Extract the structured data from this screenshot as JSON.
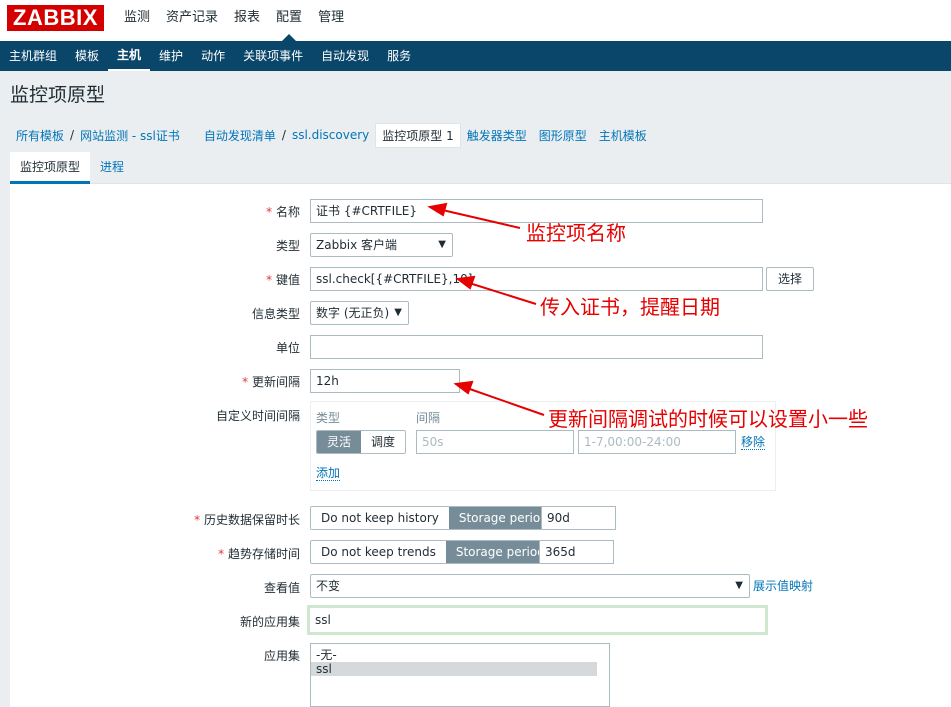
{
  "brand": {
    "logo": "ZABBIX"
  },
  "topnav": [
    "监测",
    "资产记录",
    "报表",
    "配置",
    "管理"
  ],
  "subnav": [
    "主机群组",
    "模板",
    "主机",
    "维护",
    "动作",
    "关联项事件",
    "自动发现",
    "服务"
  ],
  "page_title": "监控项原型",
  "breadcrumbs": [
    "所有模板",
    "网站监测 - ssl证书",
    "自动发现清单",
    "ssl.discovery",
    "监控项原型 1",
    "触发器类型",
    "图形原型",
    "主机模板"
  ],
  "tabs": [
    "监控项原型",
    "进程"
  ],
  "form": {
    "name_label": "名称",
    "name_value": "证书 {#CRTFILE}",
    "type_label": "类型",
    "type_value": "Zabbix 客户端",
    "key_label": "键值",
    "key_value": "ssl.check[{#CRTFILE},10]",
    "key_select": "选择",
    "info_type_label": "信息类型",
    "info_type_value": "数字 (无正负)",
    "units_label": "单位",
    "units_value": "",
    "interval_label": "更新间隔",
    "interval_value": "12h",
    "custom_label": "自定义时间间隔",
    "custom_col_type": "类型",
    "custom_col_interval": "间隔",
    "custom_flex": "灵活",
    "custom_sched": "调度",
    "custom_interval_ph": "50s",
    "custom_period_ph": "1-7,00:00-24:00",
    "custom_remove": "移除",
    "custom_add": "添加",
    "history_label": "历史数据保留时长",
    "history_no": "Do not keep history",
    "history_storage": "Storage period",
    "history_value": "90d",
    "trends_label": "趋势存储时间",
    "trends_no": "Do not keep trends",
    "trends_storage": "Storage period",
    "trends_value": "365d",
    "show_value_label": "查看值",
    "show_value_value": "不变",
    "show_value_link": "展示值映射",
    "new_app_label": "新的应用集",
    "new_app_value": "ssl",
    "apps_label": "应用集",
    "apps_options": [
      "-无-",
      "ssl"
    ]
  },
  "annotations": {
    "a1": "监控项名称",
    "a2": "传入证书，提醒日期",
    "a3": "更新间隔调试的时候可以设置小一些"
  },
  "colors": {
    "accent": "#0a466a",
    "link": "#0275b8",
    "annotation": "#e60000",
    "brand": "#d40000"
  }
}
